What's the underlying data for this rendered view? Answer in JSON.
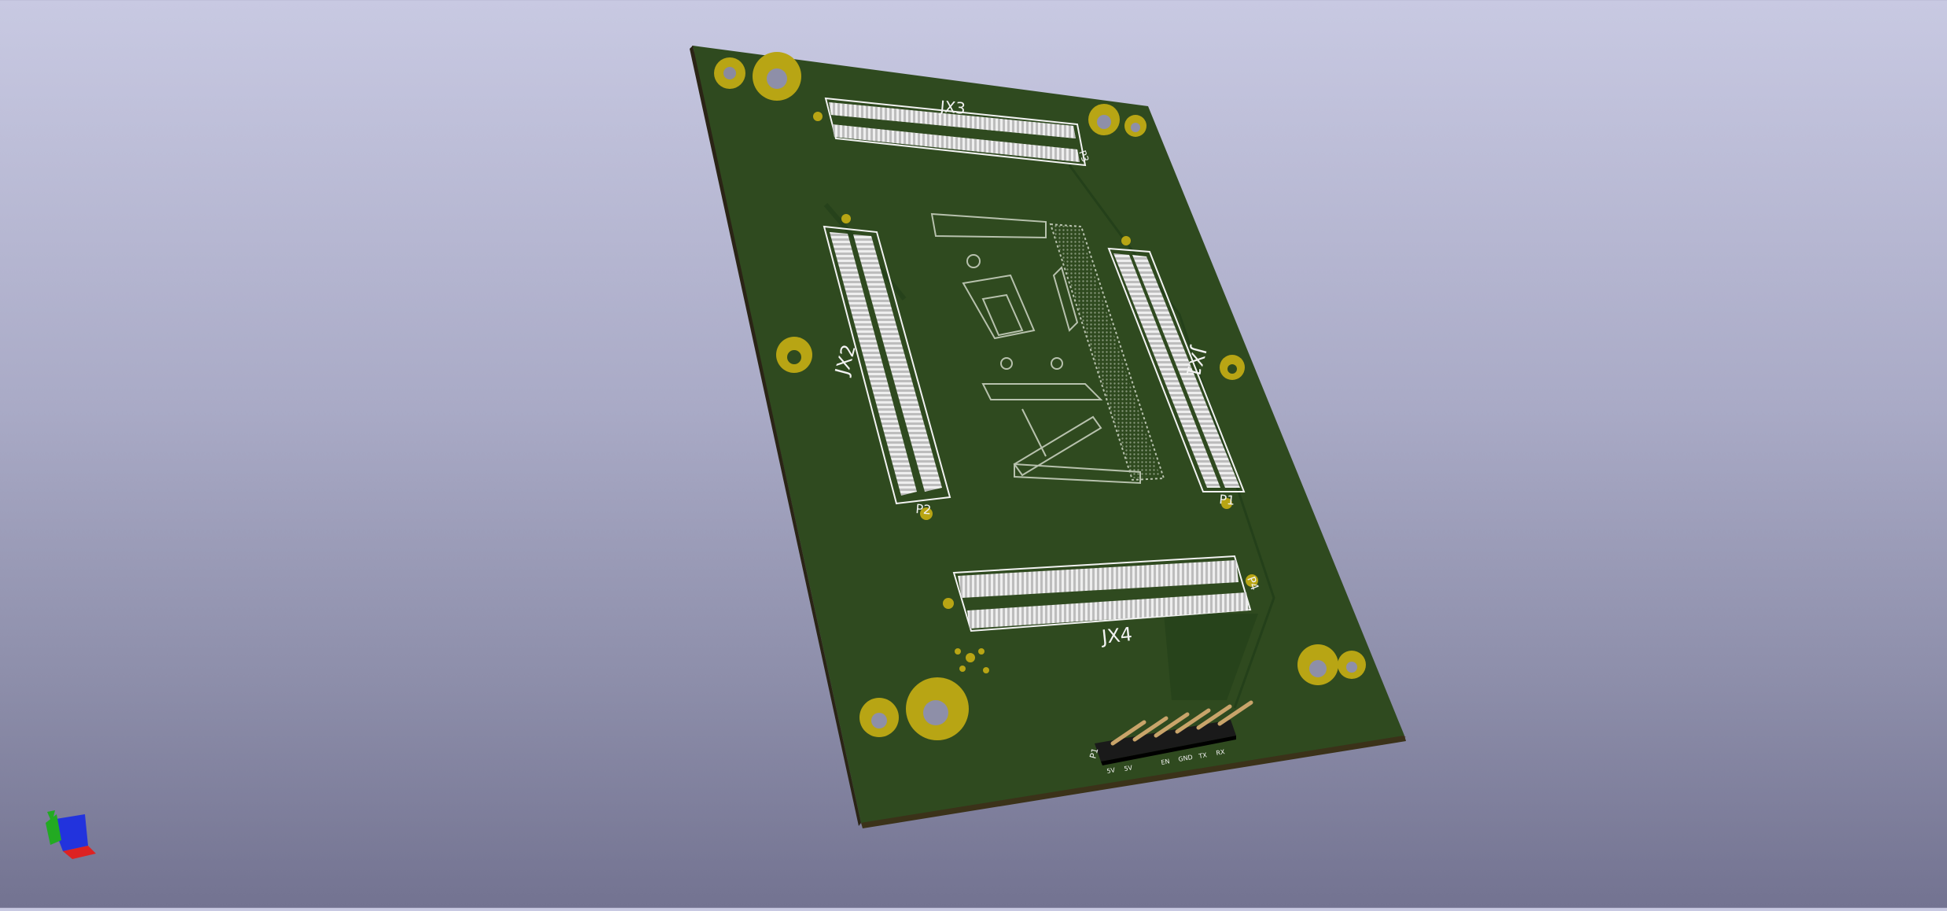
{
  "viewer": {
    "scene": "pcb-3d-view",
    "background_colors": {
      "top": "#c8c9e2",
      "bottom": "#737391"
    }
  },
  "board": {
    "colors": {
      "soldermask": "#2f4a1f",
      "edge": "#3a3420",
      "silkscreen": "#f2f2f2",
      "pads": "#b8a514",
      "connector_body": "#e6e6e6",
      "header_body": "#1a1a1a",
      "header_pins": "#c9a46a"
    },
    "connectors": {
      "jx3": {
        "label": "JX3"
      },
      "jx2": {
        "label": "JX2"
      },
      "jx1": {
        "label": "JX1"
      },
      "jx4": {
        "label": "JX4"
      }
    },
    "pin_markers": {
      "jx3": "P3",
      "jx2": "P2",
      "jx1": "P1",
      "jx4": "P4"
    },
    "header": {
      "ref": "P1",
      "pin_labels": [
        "5V",
        "5V",
        "EN",
        "GND",
        "TX",
        "RX"
      ]
    }
  },
  "axis_gizmo": {
    "icon": "3d-axis-icon",
    "colors": {
      "x": "#dd2222",
      "y": "#22aa22",
      "z": "#2233dd"
    }
  }
}
